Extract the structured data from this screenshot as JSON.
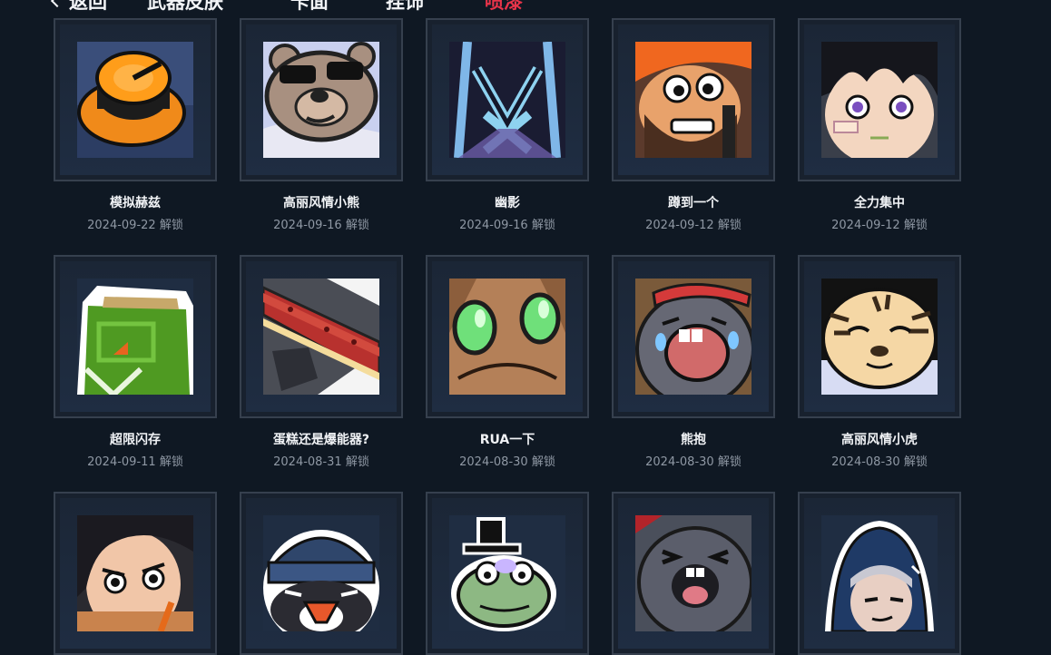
{
  "nav": {
    "back": "返回",
    "tabs": [
      "武器皮肤",
      "卡面",
      "挂饰",
      "喷漆"
    ],
    "active_tab": "喷漆",
    "active_color": "#e8344a"
  },
  "unlock_suffix": "解锁",
  "sprays": [
    {
      "name": "模拟赫兹",
      "date": "2024-09-22",
      "icon": "orange-knob-icon"
    },
    {
      "name": "高丽风情小熊",
      "date": "2024-09-16",
      "icon": "bear-sunglasses-icon"
    },
    {
      "name": "幽影",
      "date": "2024-09-16",
      "icon": "shadow-logo-icon"
    },
    {
      "name": "蹲到一个",
      "date": "2024-09-12",
      "icon": "bearded-soldier-icon"
    },
    {
      "name": "全力集中",
      "date": "2024-09-12",
      "icon": "focused-boy-icon"
    },
    {
      "name": "超限闪存",
      "date": "2024-09-11",
      "icon": "green-chip-icon"
    },
    {
      "name": "蛋糕还是爆能器?",
      "date": "2024-08-31",
      "icon": "cake-blaster-icon"
    },
    {
      "name": "RUA一下",
      "date": "2024-08-30",
      "icon": "green-eyes-icon"
    },
    {
      "name": "熊抱",
      "date": "2024-08-30",
      "icon": "crying-seal-icon"
    },
    {
      "name": "高丽风情小虎",
      "date": "2024-08-30",
      "icon": "tiger-cub-icon"
    },
    {
      "name": "",
      "date": "",
      "icon": "angry-girl-icon"
    },
    {
      "name": "",
      "date": "",
      "icon": "penguin-beanie-icon"
    },
    {
      "name": "",
      "date": "",
      "icon": "frog-hat-icon"
    },
    {
      "name": "",
      "date": "",
      "icon": "happy-seal-icon"
    },
    {
      "name": "",
      "date": "",
      "icon": "hooded-agent-icon"
    }
  ]
}
